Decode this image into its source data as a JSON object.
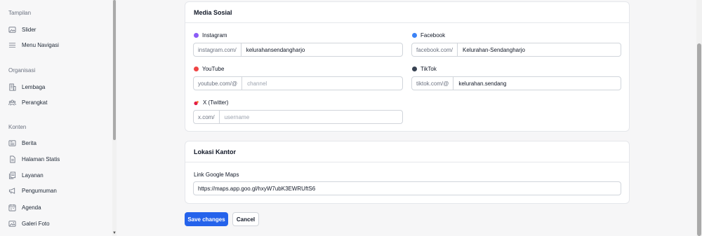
{
  "sidebar": {
    "sections": [
      {
        "title": "Tampilan",
        "items": [
          {
            "label": "Slider",
            "icon": "image-icon"
          },
          {
            "label": "Menu Navigasi",
            "icon": "menu-icon"
          }
        ]
      },
      {
        "title": "Organisasi",
        "items": [
          {
            "label": "Lembaga",
            "icon": "building-icon"
          },
          {
            "label": "Perangkat",
            "icon": "users-icon"
          }
        ]
      },
      {
        "title": "Konten",
        "items": [
          {
            "label": "Berita",
            "icon": "newspaper-icon"
          },
          {
            "label": "Halaman Statis",
            "icon": "document-icon"
          },
          {
            "label": "Layanan",
            "icon": "documents-icon"
          },
          {
            "label": "Pengumuman",
            "icon": "megaphone-icon"
          },
          {
            "label": "Agenda",
            "icon": "calendar-icon"
          },
          {
            "label": "Galeri Foto",
            "icon": "photo-icon"
          }
        ]
      }
    ]
  },
  "social": {
    "title": "Media Sosial",
    "instagram": {
      "label": "Instagram",
      "prefix": "instagram.com/",
      "value": "kelurahansendangharjo",
      "color": "#8b5cf6"
    },
    "facebook": {
      "label": "Facebook",
      "prefix": "facebook.com/",
      "value": "Kelurahan-Sendangharjo",
      "color": "#3b82f6"
    },
    "youtube": {
      "label": "YouTube",
      "prefix": "youtube.com/@",
      "placeholder": "channel",
      "color": "#ef4444"
    },
    "tiktok": {
      "label": "TikTok",
      "prefix": "tiktok.com/@",
      "value": "kelurahan.sendang",
      "color": "#374151"
    },
    "twitter": {
      "label": "X (Twitter)",
      "prefix": "x.com/",
      "placeholder": "username",
      "color": "#e11d48"
    }
  },
  "office": {
    "title": "Lokasi Kantor",
    "maps_label": "Link Google Maps",
    "maps_value": "https://maps.app.goo.gl/hxyW7ubK3EWRUftS6"
  },
  "actions": {
    "save": "Save changes",
    "cancel": "Cancel"
  }
}
